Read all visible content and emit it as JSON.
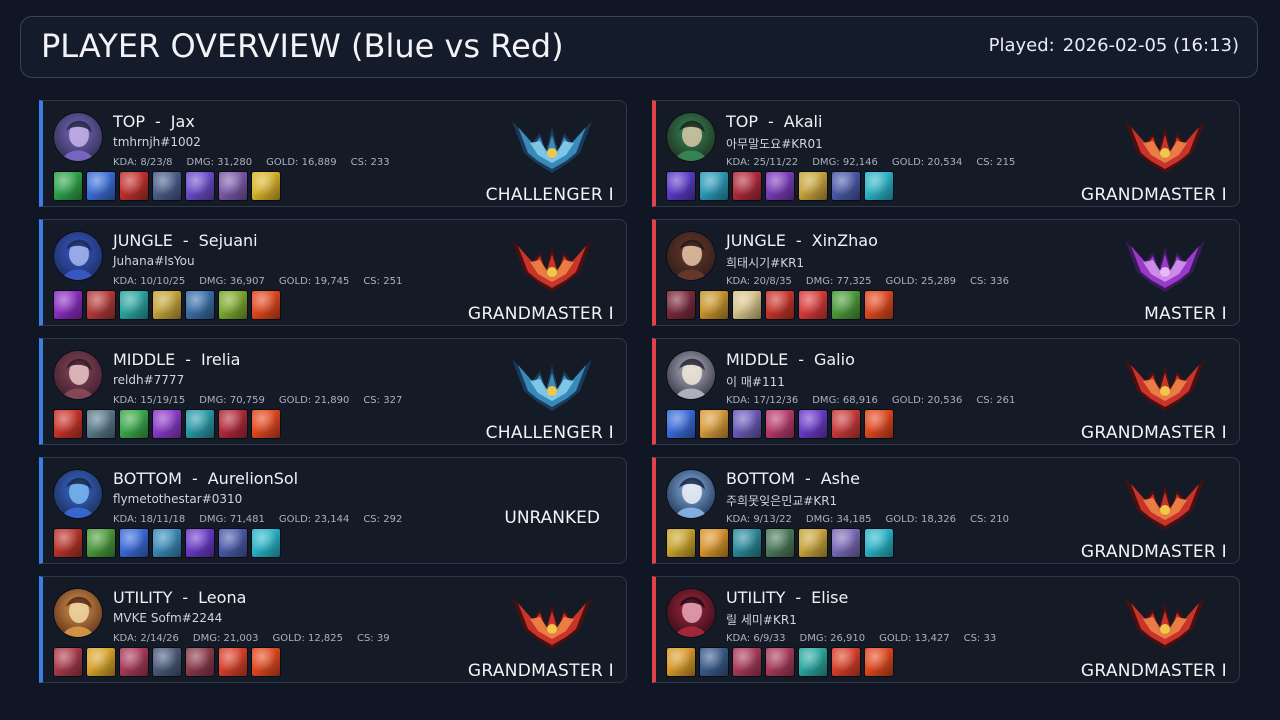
{
  "header": {
    "title": "PLAYER OVERVIEW (Blue vs Red)",
    "played_label": "Played:",
    "played_value": "2026-02-05 (16:13)"
  },
  "stat_labels": {
    "kda": "KDA:",
    "dmg": "DMG:",
    "gold": "GOLD:",
    "cs": "CS:"
  },
  "colors": {
    "blue_team": "#3b7fe6",
    "red_team": "#e0434b",
    "background": "#101624"
  },
  "teams": {
    "blue": [
      {
        "role": "TOP",
        "champion": "Jax",
        "riot_id": "tmhrnjh#1002",
        "kda": "8/23/8",
        "dmg": "31,280",
        "gold": "16,889",
        "cs": "233",
        "rank": "CHALLENGER I",
        "rank_emblem": "challenger-emblem-icon",
        "items": [
          "#2ea34a",
          "#3b6ed8",
          "#c0302e",
          "#4a5d8a",
          "#6a4cc9",
          "#7c5aa8",
          "#d8b42a"
        ]
      },
      {
        "role": "JUNGLE",
        "champion": "Sejuani",
        "riot_id": "Juhana#IsYou",
        "kda": "10/10/25",
        "dmg": "36,907",
        "gold": "19,745",
        "cs": "251",
        "rank": "GRANDMASTER I",
        "rank_emblem": "grandmaster-emblem-icon",
        "items": [
          "#8a2dbf",
          "#b43a3a",
          "#2aa5a0",
          "#c4a43a",
          "#3a6ea8",
          "#7da82e",
          "#e0481e"
        ]
      },
      {
        "role": "MIDDLE",
        "champion": "Irelia",
        "riot_id": "reldh#7777",
        "kda": "15/19/15",
        "dmg": "70,759",
        "gold": "21,890",
        "cs": "327",
        "rank": "CHALLENGER I",
        "rank_emblem": "challenger-emblem-icon",
        "items": [
          "#c8342a",
          "#5a7a8a",
          "#3aa84a",
          "#8a3ac8",
          "#2a9aa8",
          "#b02a3a",
          "#e0481e"
        ]
      },
      {
        "role": "BOTTOM",
        "champion": "AurelionSol",
        "riot_id": "flymetothestar#0310",
        "kda": "18/11/18",
        "dmg": "71,481",
        "gold": "23,144",
        "cs": "292",
        "rank": "UNRANKED",
        "rank_emblem": "",
        "items": [
          "#b8342a",
          "#4a9a3a",
          "#3a6ad8",
          "#3a8ab8",
          "#6a3ac8",
          "#4a5aa8",
          "#2ab4c8"
        ]
      },
      {
        "role": "UTILITY",
        "champion": "Leona",
        "riot_id": "MVKE Sofm#2244",
        "kda": "2/14/26",
        "dmg": "21,003",
        "gold": "12,825",
        "cs": "39",
        "rank": "GRANDMASTER I",
        "rank_emblem": "grandmaster-emblem-icon",
        "items": [
          "#a83a4a",
          "#d8a42a",
          "#a83a5a",
          "#4a5a7a",
          "#8a3a4a",
          "#d8402a",
          "#e0481e"
        ]
      }
    ],
    "red": [
      {
        "role": "TOP",
        "champion": "Akali",
        "riot_id": "아무말도요#KR01",
        "kda": "25/11/22",
        "dmg": "92,146",
        "gold": "20,534",
        "cs": "215",
        "rank": "GRANDMASTER I",
        "rank_emblem": "grandmaster-emblem-icon",
        "items": [
          "#5a3ac8",
          "#2a9ab8",
          "#b02a3a",
          "#7a3ab8",
          "#c8a43a",
          "#4a5aa8",
          "#2ab4c8"
        ]
      },
      {
        "role": "JUNGLE",
        "champion": "XinZhao",
        "riot_id": "희태시기#KR1",
        "kda": "20/8/35",
        "dmg": "77,325",
        "gold": "25,289",
        "cs": "336",
        "rank": "MASTER I",
        "rank_emblem": "master-emblem-icon",
        "items": [
          "#7a2a3a",
          "#c8942a",
          "#d8c48a",
          "#c8342a",
          "#d83a3a",
          "#4a9a3a",
          "#e0481e"
        ]
      },
      {
        "role": "MIDDLE",
        "champion": "Galio",
        "riot_id": "이 매#111",
        "kda": "17/12/36",
        "dmg": "68,916",
        "gold": "20,536",
        "cs": "261",
        "rank": "GRANDMASTER I",
        "rank_emblem": "grandmaster-emblem-icon",
        "items": [
          "#3a6ad8",
          "#d89a3a",
          "#6a5ab8",
          "#b83a6a",
          "#6a3ac8",
          "#c83a3a",
          "#e0481e"
        ]
      },
      {
        "role": "BOTTOM",
        "champion": "Ashe",
        "riot_id": "주희못잊은민교#KR1",
        "kda": "9/13/22",
        "dmg": "34,185",
        "gold": "18,326",
        "cs": "210",
        "rank": "GRANDMASTER I",
        "rank_emblem": "grandmaster-emblem-icon",
        "items": [
          "#c8a42a",
          "#d8942a",
          "#2a8a9a",
          "#4a7a5a",
          "#c8a43a",
          "#7a6ab8",
          "#2ab4c8"
        ]
      },
      {
        "role": "UTILITY",
        "champion": "Elise",
        "riot_id": "릴 세미#KR1",
        "kda": "6/9/33",
        "dmg": "26,910",
        "gold": "13,427",
        "cs": "33",
        "rank": "GRANDMASTER I",
        "rank_emblem": "grandmaster-emblem-icon",
        "items": [
          "#d89a2a",
          "#3a5a8a",
          "#a83a5a",
          "#a83a5a",
          "#2aa8a0",
          "#d8402a",
          "#e0481e"
        ]
      }
    ]
  }
}
